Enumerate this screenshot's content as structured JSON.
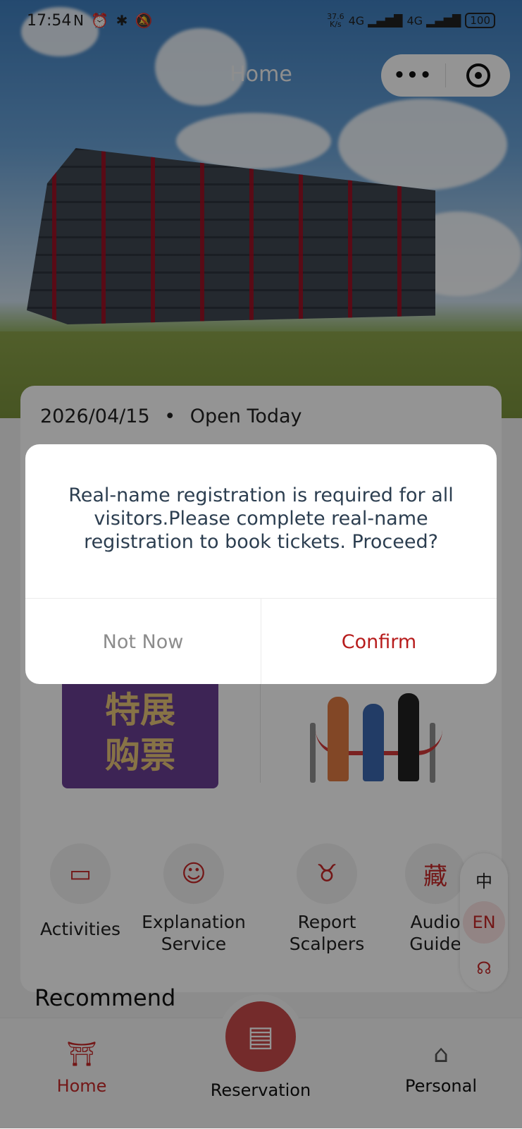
{
  "status_bar": {
    "time": "17:54",
    "left_icons": "N ⏰ ✱ 🔕",
    "net_speed_value": "37.6",
    "net_speed_unit": "K/s",
    "signal_1": "4G ▂▄▆█",
    "signal_2": "4G ▂▄▆█",
    "battery": "100"
  },
  "nav": {
    "title": "Home",
    "more_label": "•••"
  },
  "hero_card": {
    "date": "2026/04/15",
    "separator": "•",
    "status": "Open Today"
  },
  "promo": {
    "left_line1": "特展",
    "left_line2": "购票"
  },
  "services": [
    {
      "label": "Activities",
      "icon": "lectern-icon"
    },
    {
      "label": "Explanation Service",
      "icon": "headset-person-icon"
    },
    {
      "label": "Report Scalpers",
      "icon": "bull-icon"
    },
    {
      "label": "Audio Guide",
      "icon": "cloud-seal-icon"
    }
  ],
  "language_panel": {
    "zh": "中",
    "en": "EN"
  },
  "recommend_title": "Recommend",
  "tabbar": {
    "home": "Home",
    "reservation": "Reservation",
    "personal": "Personal"
  },
  "dialog": {
    "message": "Real-name registration is required for all visitors.Please complete real-name registration to book tickets. Proceed?",
    "cancel": "Not Now",
    "confirm": "Confirm"
  },
  "colors": {
    "accent": "#b71c1c",
    "cancel_text": "#8c8c8c",
    "message_text": "#2c3e50"
  }
}
